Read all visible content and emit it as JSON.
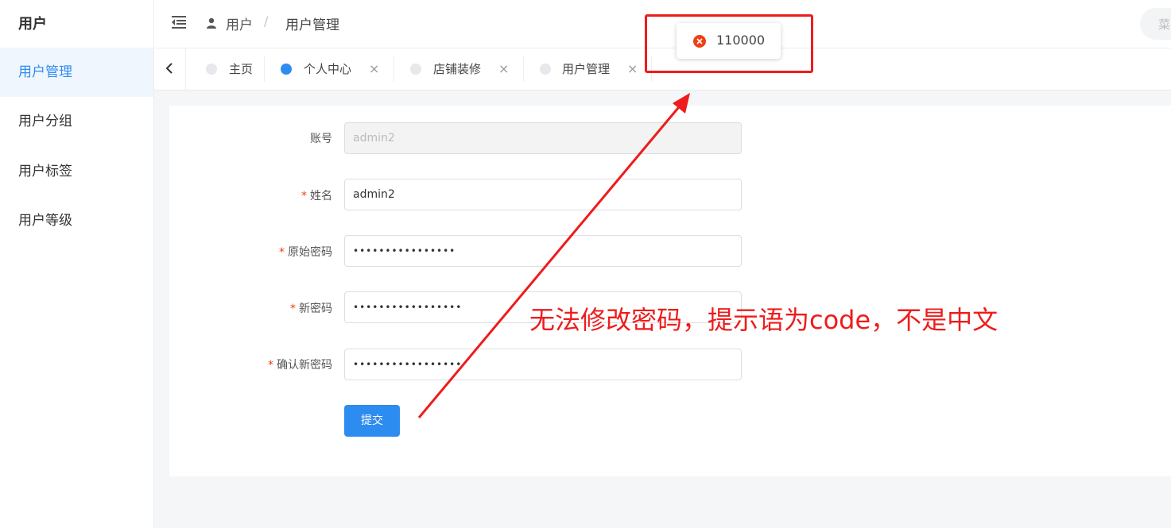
{
  "sidebar": {
    "title": "用户",
    "items": [
      {
        "label": "用户管理",
        "active": true
      },
      {
        "label": "用户分组"
      },
      {
        "label": "用户标签"
      },
      {
        "label": "用户等级"
      }
    ]
  },
  "header": {
    "breadcrumb": [
      "用户",
      "用户管理"
    ],
    "breadcrumb_sep": "/",
    "search_placeholder": "菜"
  },
  "tabs": [
    {
      "label": "主页",
      "closable": false
    },
    {
      "label": "个人中心",
      "active": true,
      "closable": true
    },
    {
      "label": "店铺装修",
      "closable": true
    },
    {
      "label": "用户管理",
      "closable": true
    }
  ],
  "form": {
    "account": {
      "label": "账号",
      "value": "admin2"
    },
    "name": {
      "label": "姓名",
      "value": "admin2"
    },
    "old_password": {
      "label": "原始密码",
      "value": "••••••••••••••••"
    },
    "new_password": {
      "label": "新密码",
      "value": "•••••••••••••••••"
    },
    "confirm_password": {
      "label": "确认新密码",
      "value": "•••••••••••••••••"
    },
    "required_mark": "*",
    "submit_label": "提交"
  },
  "toast": {
    "message": "110000",
    "type": "error"
  },
  "annotation": {
    "text": "无法修改密码，提示语为code，不是中文",
    "color": "#ee1c1c"
  },
  "colors": {
    "accent": "#2d8cf0",
    "error": "#ed4014"
  }
}
